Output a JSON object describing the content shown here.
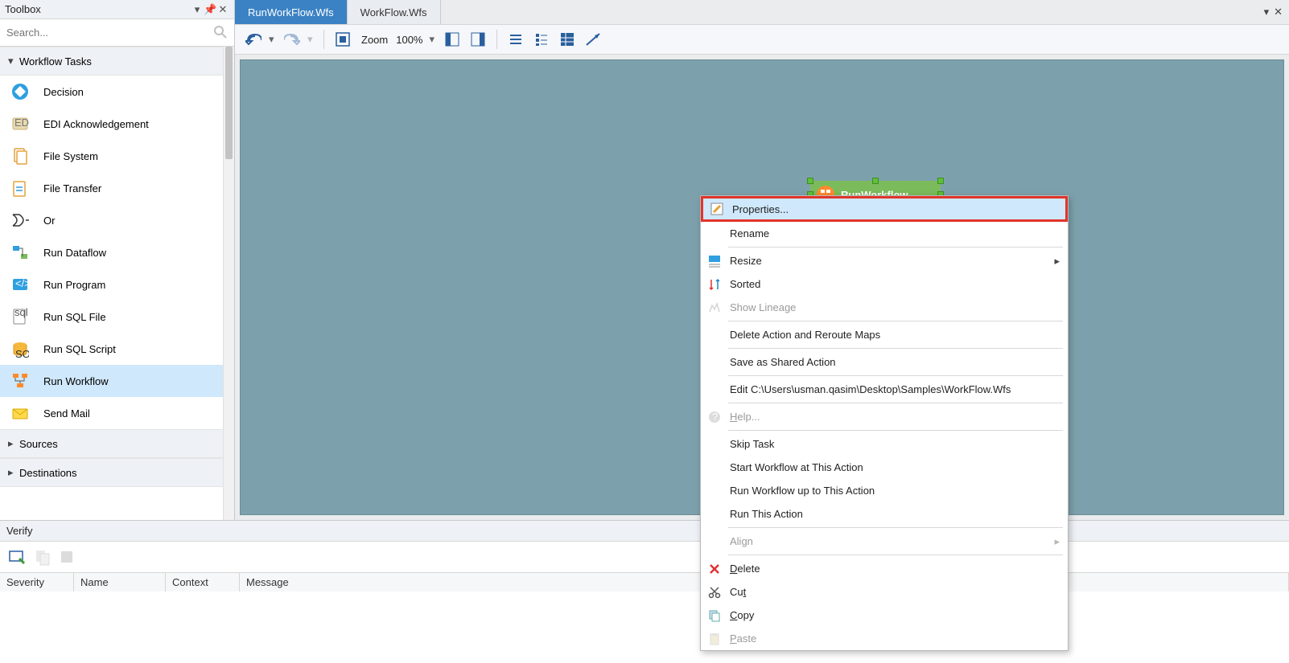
{
  "toolbox": {
    "title": "Toolbox",
    "search_placeholder": "Search...",
    "groups": {
      "workflow_tasks": "Workflow Tasks",
      "sources": "Sources",
      "destinations": "Destinations"
    },
    "items": {
      "decision": "Decision",
      "edi_ack": "EDI Acknowledgement",
      "file_system": "File System",
      "file_transfer": "File Transfer",
      "or": "Or",
      "run_dataflow": "Run Dataflow",
      "run_program": "Run Program",
      "run_sql_file": "Run SQL File",
      "run_sql_script": "Run SQL Script",
      "run_workflow": "Run Workflow",
      "send_mail": "Send Mail"
    }
  },
  "tabs": {
    "active": "RunWorkFlow.Wfs",
    "inactive": "WorkFlow.Wfs"
  },
  "toolbar": {
    "zoom_label": "Zoom",
    "zoom_value": "100%"
  },
  "node": {
    "label": "RunWorkflow"
  },
  "context_menu": {
    "properties": "Properties...",
    "rename": "Rename",
    "resize": "Resize",
    "sorted": "Sorted",
    "show_lineage": "Show Lineage",
    "delete_reroute": "Delete Action and Reroute Maps",
    "save_shared": "Save as Shared Action",
    "edit_path": "Edit C:\\Users\\usman.qasim\\Desktop\\Samples\\WorkFlow.Wfs",
    "help": "Help...",
    "skip_task": "Skip Task",
    "start_wf": "Start Workflow at This Action",
    "run_up": "Run Workflow up to This Action",
    "run_this": "Run This Action",
    "align": "Align",
    "delete": "Delete",
    "cut": "Cut",
    "copy": "Copy",
    "paste": "Paste"
  },
  "verify": {
    "title": "Verify",
    "cols": {
      "severity": "Severity",
      "name": "Name",
      "context": "Context",
      "message": "Message"
    }
  }
}
